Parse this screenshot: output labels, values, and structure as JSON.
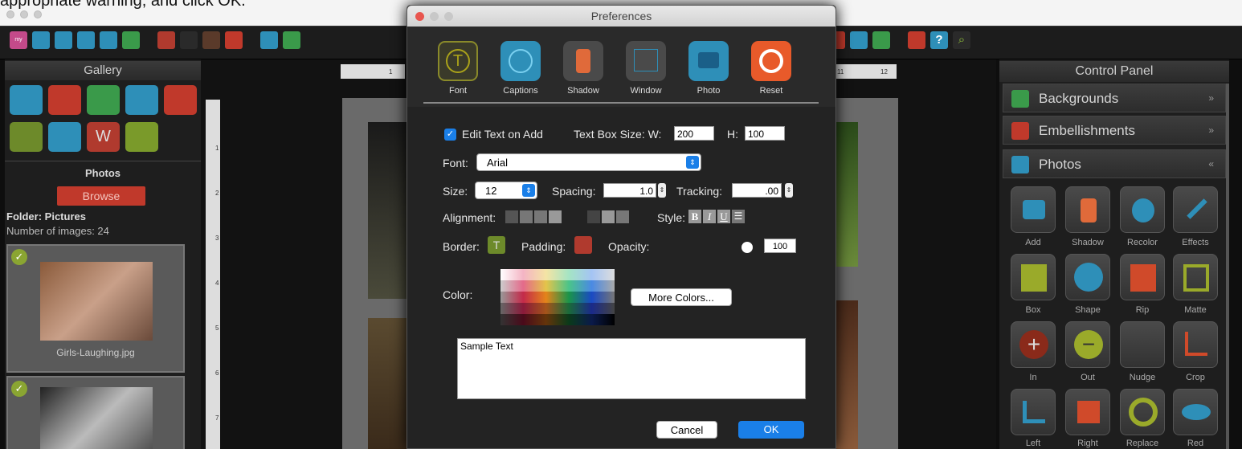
{
  "banner_text": "appropriate warning, and click OK.",
  "gallery": {
    "title": "Gallery",
    "photos_title": "Photos",
    "browse_label": "Browse",
    "folder": "Folder: Pictures",
    "num_images": "Number of images: 24",
    "thumb1_caption": "Girls-Laughing.jpg"
  },
  "control_panel": {
    "title": "Control Panel",
    "sections": [
      "Backgrounds",
      "Embellishments",
      "Photos"
    ],
    "tools_row1": [
      "Add",
      "Shadow",
      "Recolor",
      "Effects"
    ],
    "tools_row2": [
      "Box",
      "Shape",
      "Rip",
      "Matte"
    ],
    "tools_row3": [
      "In",
      "Out",
      "Nudge",
      "Crop"
    ],
    "tools_row4": [
      "Left",
      "Right",
      "Replace",
      "Red"
    ]
  },
  "ruler": {
    "top_labels": [
      "1",
      "11",
      "12"
    ],
    "left_labels": [
      "1",
      "2",
      "3",
      "4",
      "5",
      "6",
      "7"
    ]
  },
  "dialog": {
    "title": "Preferences",
    "tabs": [
      "Font",
      "Captions",
      "Shadow",
      "Window",
      "Photo",
      "Reset"
    ],
    "edit_text_label": "Edit Text on Add",
    "textbox_label": "Text Box Size: W:",
    "width": "200",
    "height_label": "H:",
    "height": "100",
    "font_label": "Font:",
    "font_value": "Arial",
    "size_label": "Size:",
    "size_value": "12",
    "spacing_label": "Spacing:",
    "spacing_value": "1.0",
    "tracking_label": "Tracking:",
    "tracking_value": ".00",
    "alignment_label": "Alignment:",
    "style_label": "Style:",
    "border_label": "Border:",
    "padding_label": "Padding:",
    "opacity_label": "Opacity:",
    "opacity_value": "100",
    "color_label": "Color:",
    "more_colors": "More Colors...",
    "sample_text": "Sample Text",
    "cancel": "Cancel",
    "ok": "OK"
  },
  "colors": {
    "accent_blue": "#1a7fe8",
    "browse_red": "#c0392b"
  }
}
